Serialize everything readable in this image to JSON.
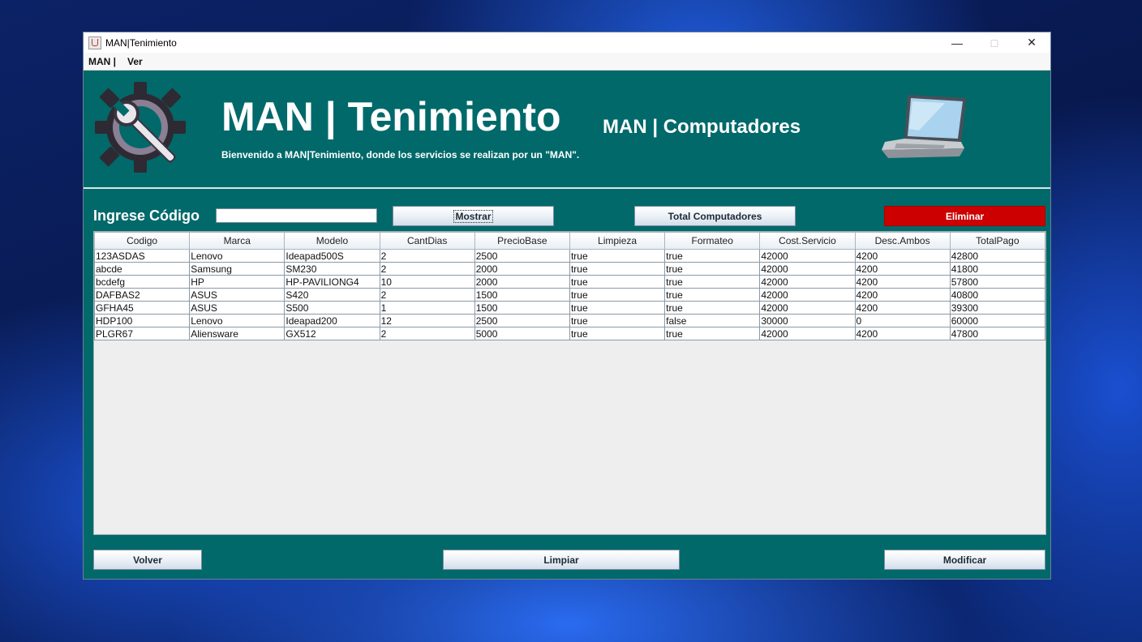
{
  "window": {
    "title": "MAN|Tenimiento"
  },
  "menu": [
    "MAN |",
    "Ver"
  ],
  "header": {
    "title": "MAN | Tenimiento",
    "subtitle": "Bienvenido a MAN|Tenimiento, donde los servicios se realizan por un \"MAN\".",
    "right_title": "MAN | Computadores"
  },
  "controls": {
    "code_label": "Ingrese Código",
    "code_value": "",
    "mostrar": "Mostrar",
    "total": "Total Computadores",
    "eliminar": "Eliminar"
  },
  "table": {
    "columns": [
      "Codigo",
      "Marca",
      "Modelo",
      "CantDias",
      "PrecioBase",
      "Limpieza",
      "Formateo",
      "Cost.Servicio",
      "Desc.Ambos",
      "TotalPago"
    ],
    "rows": [
      [
        "123ASDAS",
        "Lenovo",
        "Ideapad500S",
        "2",
        "2500",
        "true",
        "true",
        "42000",
        "4200",
        "42800"
      ],
      [
        "abcde",
        "Samsung",
        "SM230",
        "2",
        "2000",
        "true",
        "true",
        "42000",
        "4200",
        "41800"
      ],
      [
        "bcdefg",
        "HP",
        "HP-PAVILIONG4",
        "10",
        "2000",
        "true",
        "true",
        "42000",
        "4200",
        "57800"
      ],
      [
        "DAFBAS2",
        "ASUS",
        "S420",
        "2",
        "1500",
        "true",
        "true",
        "42000",
        "4200",
        "40800"
      ],
      [
        "GFHA45",
        "ASUS",
        "S500",
        "1",
        "1500",
        "true",
        "true",
        "42000",
        "4200",
        "39300"
      ],
      [
        "HDP100",
        "Lenovo",
        "Ideapad200",
        "12",
        "2500",
        "true",
        "false",
        "30000",
        "0",
        "60000"
      ],
      [
        "PLGR67",
        "Aliensware",
        "GX512",
        "2",
        "5000",
        "true",
        "true",
        "42000",
        "4200",
        "47800"
      ]
    ]
  },
  "footer": {
    "volver": "Volver",
    "limpiar": "Limpiar",
    "modificar": "Modificar"
  },
  "icons": {
    "app": "java-cup-icon",
    "logo": "gear-wrench-icon",
    "device": "laptop-icon"
  },
  "colors": {
    "panel": "#01696a",
    "danger": "#cc0000"
  }
}
